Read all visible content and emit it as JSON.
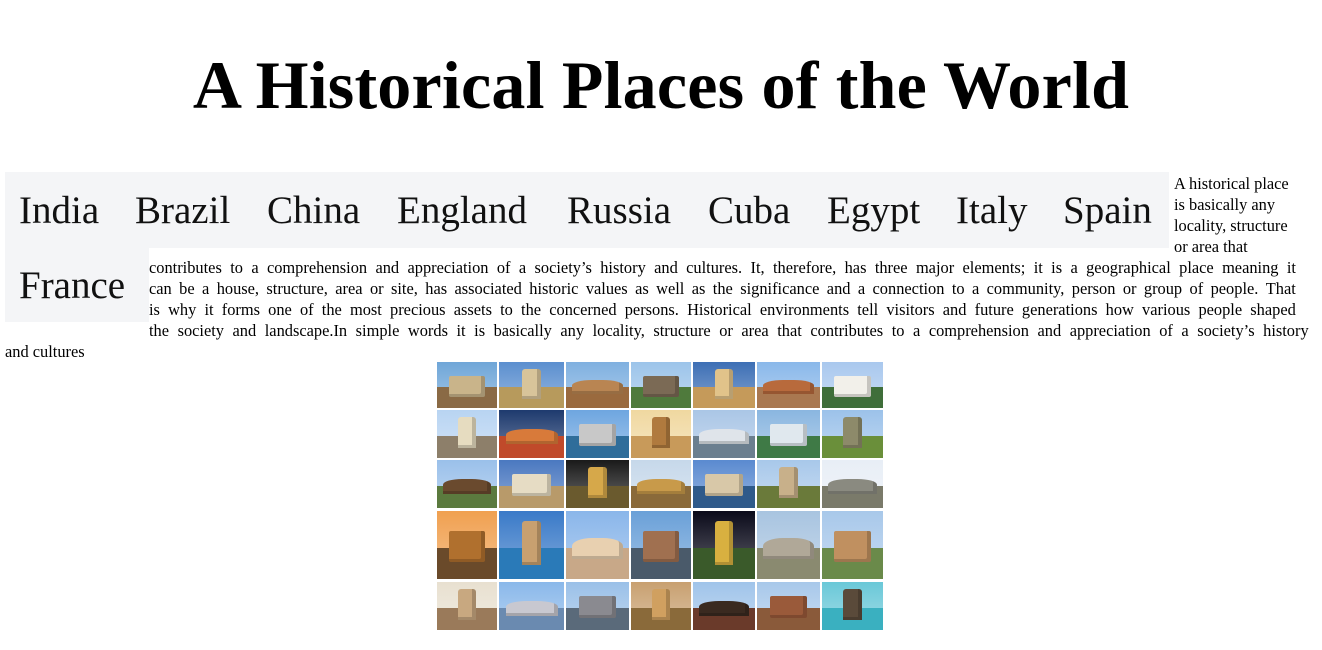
{
  "page": {
    "title": "A Historical Places of the World"
  },
  "nav": {
    "items": [
      {
        "label": "India"
      },
      {
        "label": "Brazil"
      },
      {
        "label": "China"
      },
      {
        "label": "England"
      },
      {
        "label": "Russia"
      },
      {
        "label": "Cuba"
      },
      {
        "label": "Egypt"
      },
      {
        "label": "Italy"
      },
      {
        "label": "Spain"
      },
      {
        "label": "France"
      }
    ]
  },
  "article": {
    "text": "A historical place is basically any locality, structure or area that contributes to a comprehension and appreciation of a society’s history and cultures. It, therefore, has three major elements; it is a geographical place meaning it can be a house, structure, area or site, has associated historic values as well as the significance and a connection to a community, person or group of people. That is why it forms one of the most precious assets to the concerned persons. Historical environments tell visitors and future generations how various people shaped the society and landscape.In simple words it is basically any locality, structure or area that contributes to a comprehension and appreciation of a society’s history and cultures"
  },
  "gallery": {
    "image_name": "historical-places-collage",
    "tiles": [
      {
        "sky": "#6fa6d8",
        "ground": "#8a6a45",
        "mon": "#c9b48a"
      },
      {
        "sky": "#5b8fcf",
        "ground": "#b79a5c",
        "mon": "#d8c49a"
      },
      {
        "sky": "#7fb0e0",
        "ground": "#9a6a3e",
        "mon": "#b98552"
      },
      {
        "sky": "#9cc4ea",
        "ground": "#4f7a3c",
        "mon": "#7b6a55"
      },
      {
        "sky": "#3d6fb5",
        "ground": "#c59a5a",
        "mon": "#e1c38a"
      },
      {
        "sky": "#8ab8ea",
        "ground": "#a97850",
        "mon": "#b86a3c"
      },
      {
        "sky": "#a9c8ee",
        "ground": "#3f6e3a",
        "mon": "#f2f0ea"
      },
      {
        "sky": "#b8d4f2",
        "ground": "#8d7f6a",
        "mon": "#e6dcc0"
      },
      {
        "sky": "#1e3a6e",
        "ground": "#c04a2a",
        "mon": "#d87a3a"
      },
      {
        "sky": "#6ea6e0",
        "ground": "#2f6d9a",
        "mon": "#c8c8c8"
      },
      {
        "sky": "#f0d8a0",
        "ground": "#c89a5a",
        "mon": "#b07a3e"
      },
      {
        "sky": "#aac6e6",
        "ground": "#6b7f8f",
        "mon": "#dfe4ea"
      },
      {
        "sky": "#8ab6e0",
        "ground": "#3f7a46",
        "mon": "#e0e8ee"
      },
      {
        "sky": "#9cc2ea",
        "ground": "#6a8f3a",
        "mon": "#8d8a6a"
      },
      {
        "sky": "#9ac0ea",
        "ground": "#5b7a3e",
        "mon": "#6a4a2e"
      },
      {
        "sky": "#4a78c0",
        "ground": "#b89a6a",
        "mon": "#e6dcc4"
      },
      {
        "sky": "#1a1a1a",
        "ground": "#6a5a2e",
        "mon": "#d6a84a"
      },
      {
        "sky": "#c6d8ea",
        "ground": "#8a6a3a",
        "mon": "#c89a4a"
      },
      {
        "sky": "#5a8ad0",
        "ground": "#2f5a8a",
        "mon": "#d8c8a8"
      },
      {
        "sky": "#a8c8ea",
        "ground": "#6a7a3a",
        "mon": "#c8b08a"
      },
      {
        "sky": "#e8eef6",
        "ground": "#7a7a6a",
        "mon": "#8a8a80"
      },
      {
        "sky": "#f0a050",
        "ground": "#6a4a2a",
        "mon": "#b0702e"
      },
      {
        "sky": "#3a7ac8",
        "ground": "#2a7ab8",
        "mon": "#c8a070"
      },
      {
        "sky": "#8ab6ea",
        "ground": "#c8a888",
        "mon": "#e8d0b0"
      },
      {
        "sky": "#6aa0d8",
        "ground": "#4a5a6a",
        "mon": "#a07050"
      },
      {
        "sky": "#0a0a1a",
        "ground": "#3a5a2a",
        "mon": "#d8b040"
      },
      {
        "sky": "#a8c4e0",
        "ground": "#8a8a70",
        "mon": "#b0a898"
      },
      {
        "sky": "#a8c8ea",
        "ground": "#6a8a4a",
        "mon": "#c09060"
      },
      {
        "sky": "#e8e0d0",
        "ground": "#9a7a5a",
        "mon": "#c8a880"
      },
      {
        "sky": "#8ab8ea",
        "ground": "#6a8ab0",
        "mon": "#c8c8d0"
      },
      {
        "sky": "#9ac0e8",
        "ground": "#5a6a7a",
        "mon": "#8a8a90"
      },
      {
        "sky": "#c8a070",
        "ground": "#8a6a3a",
        "mon": "#d0a060"
      },
      {
        "sky": "#a0c4ea",
        "ground": "#6a3a2a",
        "mon": "#3a2a20"
      },
      {
        "sky": "#a8c8ea",
        "ground": "#8a5a3a",
        "mon": "#9a5a3a"
      },
      {
        "sky": "#6ac8d8",
        "ground": "#3ab0c0",
        "mon": "#5a4a3a"
      }
    ]
  }
}
